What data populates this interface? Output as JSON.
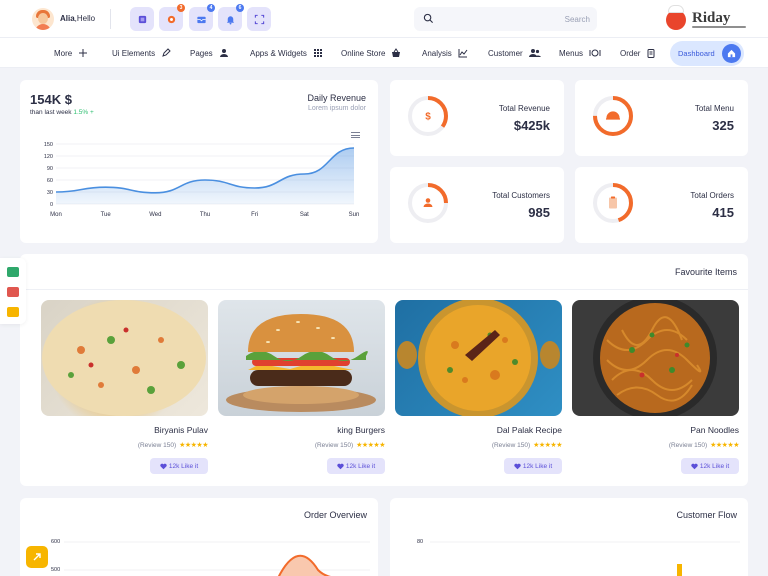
{
  "user": {
    "name": "Alia",
    "greeting": ",Hello"
  },
  "toolbar": {
    "buttons": [
      {
        "name": "layers",
        "badge": ""
      },
      {
        "name": "settings",
        "badge": "3"
      },
      {
        "name": "inbox",
        "badge": "4"
      },
      {
        "name": "notifications",
        "badge": "6"
      },
      {
        "name": "fullscreen",
        "badge": ""
      }
    ]
  },
  "search": {
    "placeholder": "Search"
  },
  "brand": {
    "name": "Riday"
  },
  "nav": {
    "items": [
      "More",
      "Ui Elements",
      "Pages",
      "Apps & Widgets",
      "Online Store",
      "Analysis",
      "Customer",
      "Menus",
      "Order"
    ],
    "dashboard": "Dashboard"
  },
  "revenue": {
    "value": "154K $",
    "sub_prefix": "than last week",
    "change": "1.5% +",
    "title": "Daily Revenue",
    "desc": "Lorem ipsum dolor"
  },
  "chart_data": {
    "type": "area",
    "categories": [
      "Mon",
      "Tue",
      "Wed",
      "Thu",
      "Fri",
      "Sat",
      "Sun"
    ],
    "series": [
      {
        "values": [
          30,
          42,
          28,
          60,
          40,
          75,
          140
        ]
      }
    ],
    "ylim": [
      0,
      150
    ],
    "yticks": [
      0,
      30,
      60,
      90,
      120,
      150
    ],
    "color": "#4a8fe0"
  },
  "stats": [
    {
      "label": "Total Revenue",
      "value": "$425k",
      "icon": "dollar-icon",
      "progress": 0.35
    },
    {
      "label": "Total Menu",
      "value": "325",
      "icon": "cloche-icon",
      "progress": 0.75
    },
    {
      "label": "Total Customers",
      "value": "985",
      "icon": "user-icon",
      "progress": 0.25
    },
    {
      "label": "Total Orders",
      "value": "415",
      "icon": "clipboard-icon",
      "progress": 0.45
    }
  ],
  "favourites": {
    "title": "Favourite Items",
    "items": [
      {
        "name": "Biryanis Pulav",
        "review": "(Review 150)",
        "stars": "★★★★★",
        "likes": "12k Like it"
      },
      {
        "name": "king Burgers",
        "review": "(Review 150)",
        "stars": "★★★★★",
        "likes": "12k Like it"
      },
      {
        "name": "Dal Palak Recipe",
        "review": "(Review 150)",
        "stars": "★★★★★",
        "likes": "12k Like it"
      },
      {
        "name": "Pan Noodles",
        "review": "(Review 150)",
        "stars": "★★★★★",
        "likes": "12k Like it"
      }
    ]
  },
  "order_overview": {
    "title": "Order Overview",
    "yticks": [
      "600",
      "500"
    ]
  },
  "customer_flow": {
    "title": "Customer Flow",
    "yticks": [
      "80"
    ]
  },
  "colors": {
    "accent": "#f26b2b",
    "primary": "#4c79f0",
    "soft": "#e4e3fb",
    "star": "#f7b500"
  }
}
